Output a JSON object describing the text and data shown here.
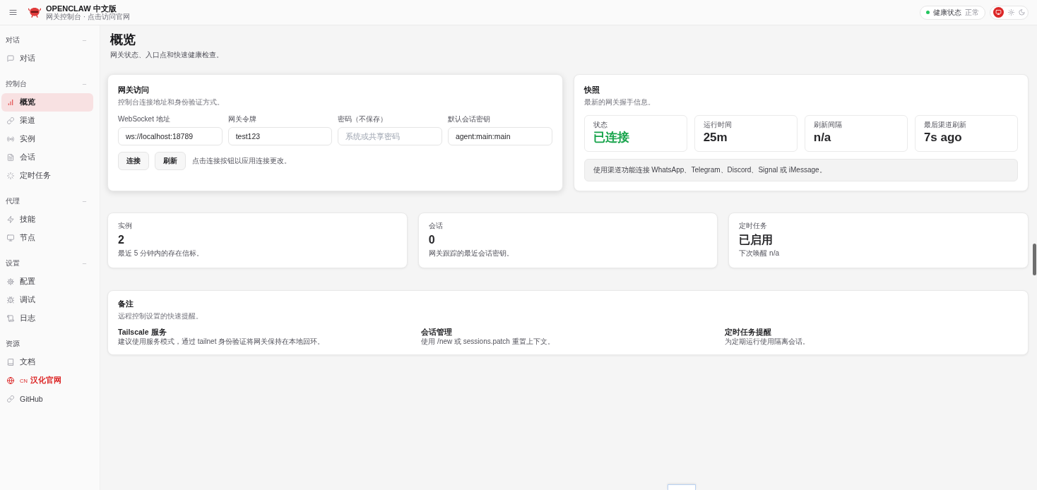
{
  "topbar": {
    "brand_title": "OPENCLAW 中文版",
    "brand_subtitle": "网关控制台 · 点击访问官网",
    "health": {
      "label": "健康状态",
      "value": "正常",
      "ok": true
    },
    "theme_modes": [
      {
        "selected": true
      },
      {
        "selected": false
      },
      {
        "selected": false
      }
    ]
  },
  "sidebar": {
    "sections": [
      {
        "title": "对话",
        "expanded": true,
        "items": [
          {
            "label": "对话",
            "selected": false
          }
        ]
      },
      {
        "title": "控制台",
        "expanded": true,
        "items": [
          {
            "label": "概览",
            "selected": true
          },
          {
            "label": "渠道",
            "selected": false
          },
          {
            "label": "实例",
            "selected": false
          },
          {
            "label": "会话",
            "selected": false
          },
          {
            "label": "定时任务",
            "selected": false
          }
        ]
      },
      {
        "title": "代理",
        "expanded": true,
        "items": [
          {
            "label": "技能",
            "selected": false
          },
          {
            "label": "节点",
            "selected": false
          }
        ]
      },
      {
        "title": "设置",
        "expanded": true,
        "items": [
          {
            "label": "配置",
            "selected": false
          },
          {
            "label": "调试",
            "selected": false
          },
          {
            "label": "日志",
            "selected": false
          }
        ]
      },
      {
        "title": "资源",
        "items": [
          {
            "label": "文档",
            "selected": false,
            "kind": "link"
          },
          {
            "label": "汉化官网",
            "badge": "CN",
            "selected": false,
            "kind": "promo"
          },
          {
            "label": "GitHub",
            "selected": false,
            "kind": "link"
          }
        ]
      }
    ]
  },
  "page": {
    "title": "概览",
    "subtitle": "网关状态、入口点和快速健康检查。"
  },
  "gateway_card": {
    "title": "网关访问",
    "subtitle": "控制台连接地址和身份验证方式。",
    "fields": [
      {
        "label": "WebSocket 地址",
        "value": "ws://localhost:18789"
      },
      {
        "label": "网关令牌",
        "value": "test123"
      },
      {
        "label": "密码（不保存）",
        "placeholder": "系统或共享密码"
      },
      {
        "label": "默认会话密钥",
        "value": "agent:main:main"
      }
    ],
    "buttons": [
      "连接",
      "刷新"
    ],
    "hint": "点击连接按钮以应用连接更改。"
  },
  "snapshot_card": {
    "title": "快照",
    "subtitle": "最新的网关握手信息。",
    "stats": [
      {
        "label": "状态",
        "value": "已连接",
        "color": "#16a34a"
      },
      {
        "label": "运行时间",
        "value": "25m",
        "color": "#27272a"
      },
      {
        "label": "刷新间隔",
        "value": "n/a",
        "color": "#27272a"
      },
      {
        "label": "最后渠道刷新",
        "value": "7s ago",
        "color": "#27272a"
      }
    ],
    "callout": "使用渠道功能连接 WhatsApp、Telegram、Discord、Signal 或 iMessage。"
  },
  "summary_cards": [
    {
      "label": "实例",
      "value": "2",
      "note": "最近 5 分钟内的存在信标。"
    },
    {
      "label": "会话",
      "value": "0",
      "note": "网关跟踪的最近会话密钥。"
    },
    {
      "label": "定时任务",
      "value": "已启用",
      "note": "下次唤醒 n/a"
    }
  ],
  "notes_card": {
    "title": "备注",
    "subtitle": "远程控制设置的快速提醒。",
    "items": [
      {
        "title": "Tailscale 服务",
        "text": "建议使用服务模式，通过 tailnet 身份验证将网关保持在本地回环。"
      },
      {
        "title": "会话管理",
        "text": "使用 /new 或 sessions.patch 重置上下文。"
      },
      {
        "title": "定时任务提醒",
        "text": "为定期运行使用隔离会话。"
      }
    ]
  }
}
